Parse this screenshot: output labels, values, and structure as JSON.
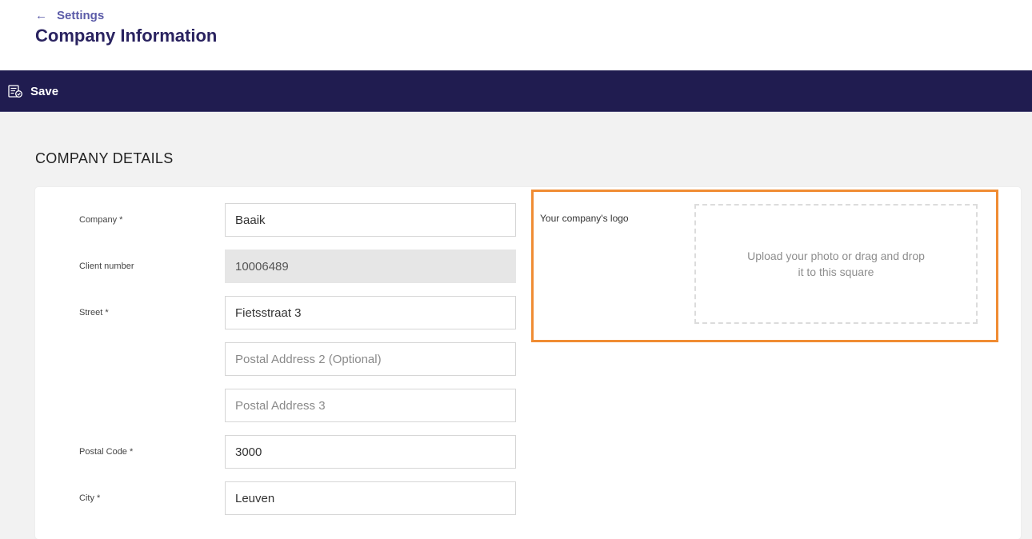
{
  "header": {
    "back_label": "Settings",
    "title": "Company Information"
  },
  "toolbar": {
    "save_label": "Save",
    "save_icon": "save-document-icon"
  },
  "section": {
    "title": "COMPANY DETAILS"
  },
  "form": {
    "company": {
      "label": "Company *",
      "value": "Baaik"
    },
    "client_number": {
      "label": "Client number",
      "value": "10006489"
    },
    "street": {
      "label": "Street *",
      "value": "Fietsstraat 3"
    },
    "address2": {
      "placeholder": "Postal Address 2 (Optional)"
    },
    "address3": {
      "placeholder": "Postal Address 3"
    },
    "postal_code": {
      "label": "Postal Code *",
      "value": "3000"
    },
    "city": {
      "label": "City *",
      "value": "Leuven"
    }
  },
  "logo": {
    "label": "Your company's logo",
    "dropzone_text": "Upload your photo or drag and drop it to this square",
    "highlight_color": "#f08c33"
  },
  "colors": {
    "toolbar_bg": "#201c50",
    "title": "#2a2360",
    "link": "#5b5ba8"
  }
}
